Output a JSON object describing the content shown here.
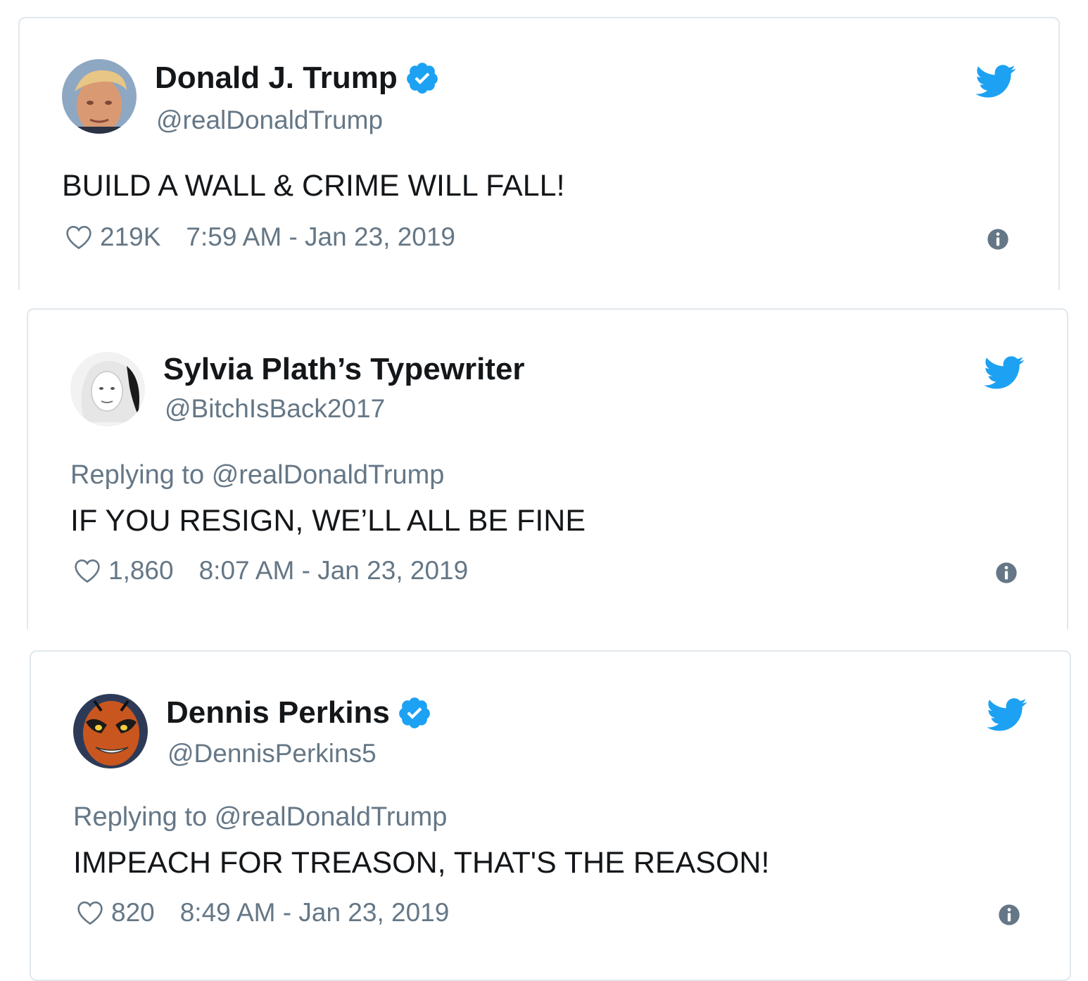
{
  "tweets": [
    {
      "name": "Donald J. Trump",
      "handle": "@realDonaldTrump",
      "verified": true,
      "replying_label": "",
      "replying_to": "",
      "text": "BUILD A WALL & CRIME WILL FALL!",
      "likes": "219K",
      "timestamp": "7:59 AM - Jan 23, 2019"
    },
    {
      "name": "Sylvia Plath’s Typewriter",
      "handle": "@BitchIsBack2017",
      "verified": false,
      "replying_label": "Replying to",
      "replying_to": "@realDonaldTrump",
      "text": "IF YOU RESIGN, WE’LL ALL BE FINE",
      "likes": "1,860",
      "timestamp": "8:07 AM - Jan 23, 2019"
    },
    {
      "name": "Dennis Perkins",
      "handle": "@DennisPerkins5",
      "verified": true,
      "replying_label": "Replying to",
      "replying_to": "@realDonaldTrump",
      "text": "IMPEACH FOR TREASON, THAT'S THE REASON!",
      "likes": "820",
      "timestamp": "8:49 AM - Jan 23, 2019"
    }
  ],
  "colors": {
    "twitter_blue": "#1da1f2",
    "text_primary": "#14171a",
    "text_secondary": "#657786",
    "border": "#e1e8ed"
  },
  "icons": {
    "verified": "verified-badge-icon",
    "bird": "twitter-bird-icon",
    "heart": "heart-outline-icon",
    "info": "info-circle-icon"
  }
}
